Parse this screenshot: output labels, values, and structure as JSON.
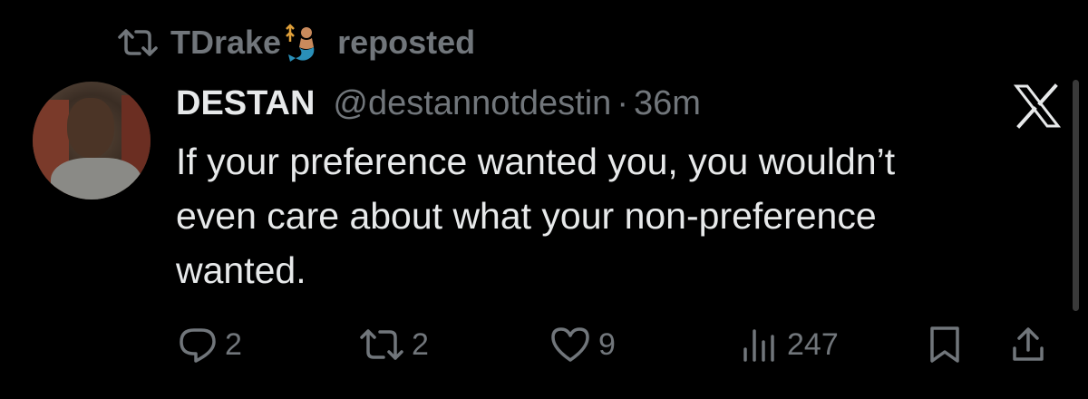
{
  "repost": {
    "icon": "repost-icon",
    "user": "TDrake",
    "emoji": "merman-emoji",
    "label": "reposted"
  },
  "tweet": {
    "avatar": "avatar",
    "display_name": "DESTAN",
    "handle": "@destannotdestin",
    "separator": "·",
    "time": "36m",
    "platform_icon": "x-logo-icon",
    "text_lines": [
      "If your preference wanted you, you wouldn’t",
      "even care about what your non-preference",
      "wanted."
    ]
  },
  "actions": {
    "reply": {
      "icon": "reply-icon",
      "count": "2"
    },
    "repost": {
      "icon": "repost-icon",
      "count": "2"
    },
    "like": {
      "icon": "heart-icon",
      "count": "9"
    },
    "views": {
      "icon": "views-icon",
      "count": "247"
    },
    "bookmark": {
      "icon": "bookmark-icon"
    },
    "share": {
      "icon": "share-icon"
    }
  },
  "colors": {
    "background": "#000000",
    "primary_text": "#e7e9ea",
    "secondary_text": "#71767b"
  }
}
